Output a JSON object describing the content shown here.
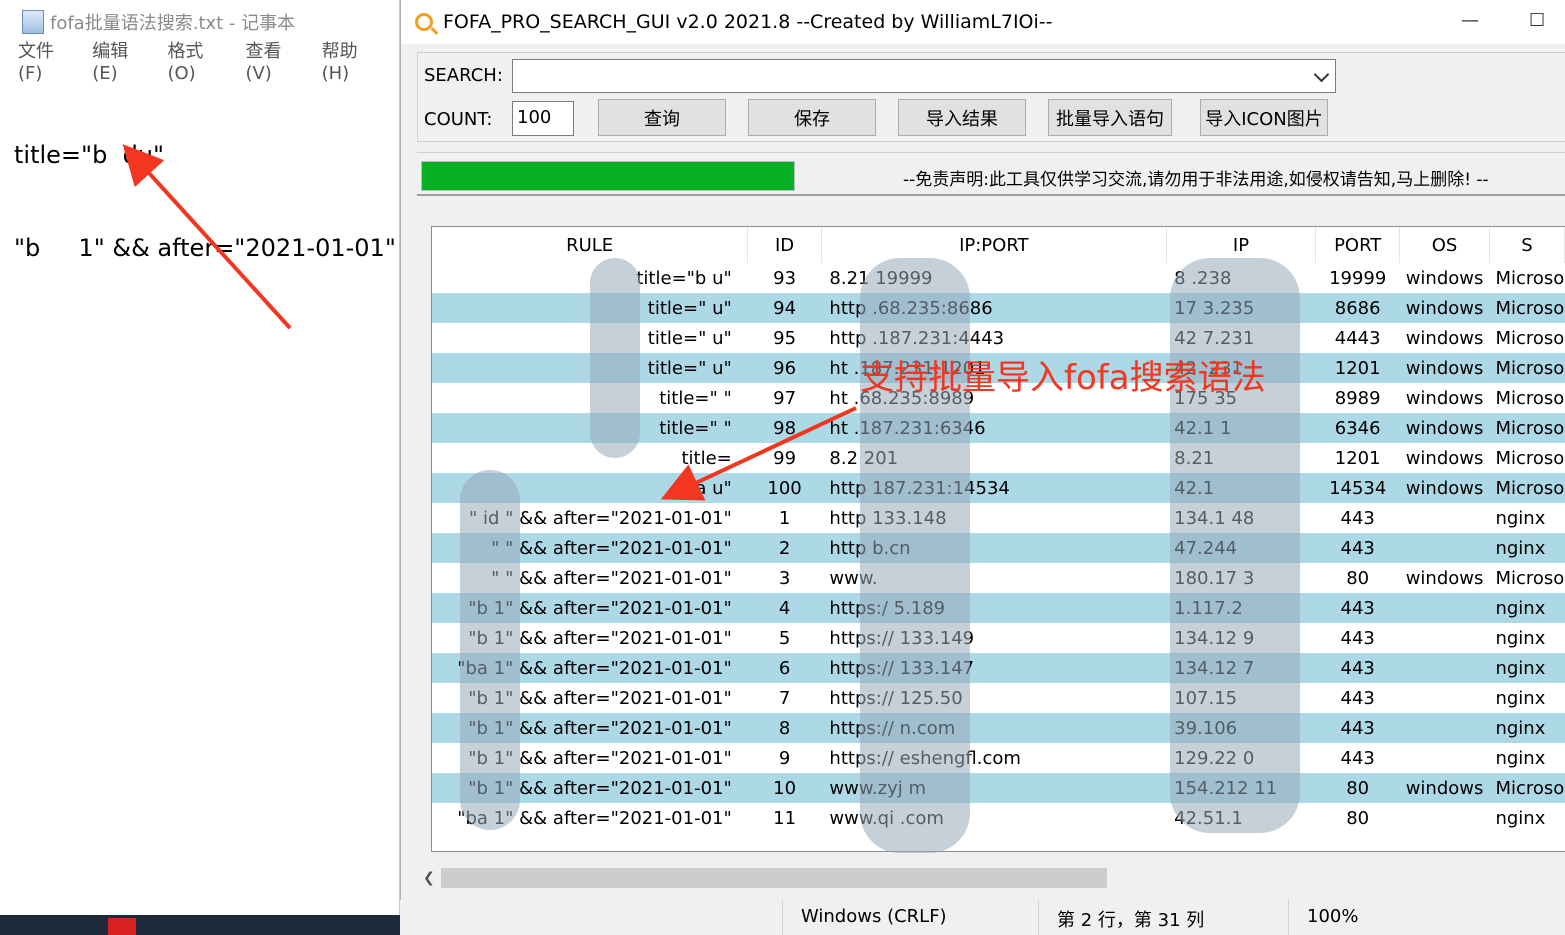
{
  "notepad": {
    "title": "fofa批量语法搜索.txt - 记事本",
    "menu": [
      "文件(F)",
      "编辑(E)",
      "格式(O)",
      "查看(V)",
      "帮助(H)"
    ],
    "lines": [
      "title=\"b  du\"",
      "\"b     1\" && after=\"2021-01-01\""
    ]
  },
  "app": {
    "title": "FOFA_PRO_SEARCH_GUI  v2.0   2021.8     --Created by WilliamL7IOi--",
    "search_label": "SEARCH:",
    "search_value": "",
    "count_label": "COUNT:",
    "count_value": "100",
    "buttons": {
      "query": "查询",
      "save": "保存",
      "import_results": "导入结果",
      "batch_import": "批量导入语句",
      "import_icon": "导入ICON图片"
    },
    "progress_percent": 100,
    "disclaimer": "--免责声明:此工具仅供学习交流,请勿用于非法用途,如侵权请告知,马上删除! --"
  },
  "table": {
    "columns": [
      "RULE",
      "ID",
      "IP:PORT",
      "IP",
      "PORT",
      "OS",
      "S"
    ],
    "rows": [
      {
        "rule": "title=\"b    u\"",
        "id": "93",
        "ipport": "8.21          19999",
        "ip": "8        .238",
        "port": "19999",
        "os": "windows",
        "server": "Microso"
      },
      {
        "rule": "title=\"     u\"",
        "id": "94",
        "ipport": "http          .68.235:8686",
        "ip": "17        3.235",
        "port": "8686",
        "os": "windows",
        "server": "Microso"
      },
      {
        "rule": "title=\"     u\"",
        "id": "95",
        "ipport": "http          .187.231:4443",
        "ip": "42        7.231",
        "port": "4443",
        "os": "windows",
        "server": "Microso"
      },
      {
        "rule": "title=\"     u\"",
        "id": "96",
        "ipport": "ht           .187.231:1201",
        "ip": "42        .231",
        "port": "1201",
        "os": "windows",
        "server": "Microso"
      },
      {
        "rule": "title=\"      \"",
        "id": "97",
        "ipport": "ht           .68.235:8989",
        "ip": "175        35",
        "port": "8989",
        "os": "windows",
        "server": "Microso"
      },
      {
        "rule": "title=\"      \"",
        "id": "98",
        "ipport": "ht           .187.231:6346",
        "ip": "42.1        1",
        "port": "6346",
        "os": "windows",
        "server": "Microso"
      },
      {
        "rule": "title=        ",
        "id": "99",
        "ipport": "8.2           201",
        "ip": "8.21        ",
        "port": "1201",
        "os": "windows",
        "server": "Microso"
      },
      {
        "rule": "   ba    u\"",
        "id": "100",
        "ipport": "http          187.231:14534",
        "ip": "42.1        ",
        "port": "14534",
        "os": "windows",
        "server": "Microso"
      },
      {
        "rule": "\"  id    \" && after=\"2021-01-01\"",
        "id": "1",
        "ipport": "http          133.148",
        "ip": "134.1       48",
        "port": "443",
        "os": "",
        "server": "nginx"
      },
      {
        "rule": "\"        \" && after=\"2021-01-01\"",
        "id": "2",
        "ipport": "http          b.cn",
        "ip": "47.244       ",
        "port": "443",
        "os": "",
        "server": "nginx"
      },
      {
        "rule": "\"       \" && after=\"2021-01-01\"",
        "id": "3",
        "ipport": "www.          ",
        "ip": "180.17       3",
        "port": "80",
        "os": "windows",
        "server": "Microso"
      },
      {
        "rule": "\"b     1\" && after=\"2021-01-01\"",
        "id": "4",
        "ipport": "https:/       5.189",
        "ip": "1.117.2      ",
        "port": "443",
        "os": "",
        "server": "nginx"
      },
      {
        "rule": "\"b     1\" && after=\"2021-01-01\"",
        "id": "5",
        "ipport": "https://      133.149",
        "ip": "134.12       9",
        "port": "443",
        "os": "",
        "server": "nginx"
      },
      {
        "rule": "\"ba    1\" && after=\"2021-01-01\"",
        "id": "6",
        "ipport": "https://      133.147",
        "ip": "134.12       7",
        "port": "443",
        "os": "",
        "server": "nginx"
      },
      {
        "rule": "\"b     1\" && after=\"2021-01-01\"",
        "id": "7",
        "ipport": "https://      125.50",
        "ip": "107.15       ",
        "port": "443",
        "os": "",
        "server": "nginx"
      },
      {
        "rule": "\"b     1\" && after=\"2021-01-01\"",
        "id": "8",
        "ipport": "https://      n.com",
        "ip": "39.106       ",
        "port": "443",
        "os": "",
        "server": "nginx"
      },
      {
        "rule": "\"b     1\" && after=\"2021-01-01\"",
        "id": "9",
        "ipport": "https://      eshengfl.com",
        "ip": "129.22       0",
        "port": "443",
        "os": "",
        "server": "nginx"
      },
      {
        "rule": "\"b     1\" && after=\"2021-01-01\"",
        "id": "10",
        "ipport": "www.zyj       m",
        "ip": "154.212      11",
        "port": "80",
        "os": "windows",
        "server": "Microso"
      },
      {
        "rule": "\"ba    1\" && after=\"2021-01-01\"",
        "id": "11",
        "ipport": "www.qi       .com",
        "ip": "42.51.1      ",
        "port": "80",
        "os": "",
        "server": "nginx"
      }
    ]
  },
  "statusbar": {
    "line_ending": "Windows (CRLF)",
    "position": "第 2 行，第 31 列",
    "zoom": "100%"
  },
  "annotation": {
    "text": "支持批量导入fofa搜索语法",
    "color": "#f2361f"
  },
  "colors": {
    "progress": "#06b025",
    "row_alt": "#add8e6"
  }
}
